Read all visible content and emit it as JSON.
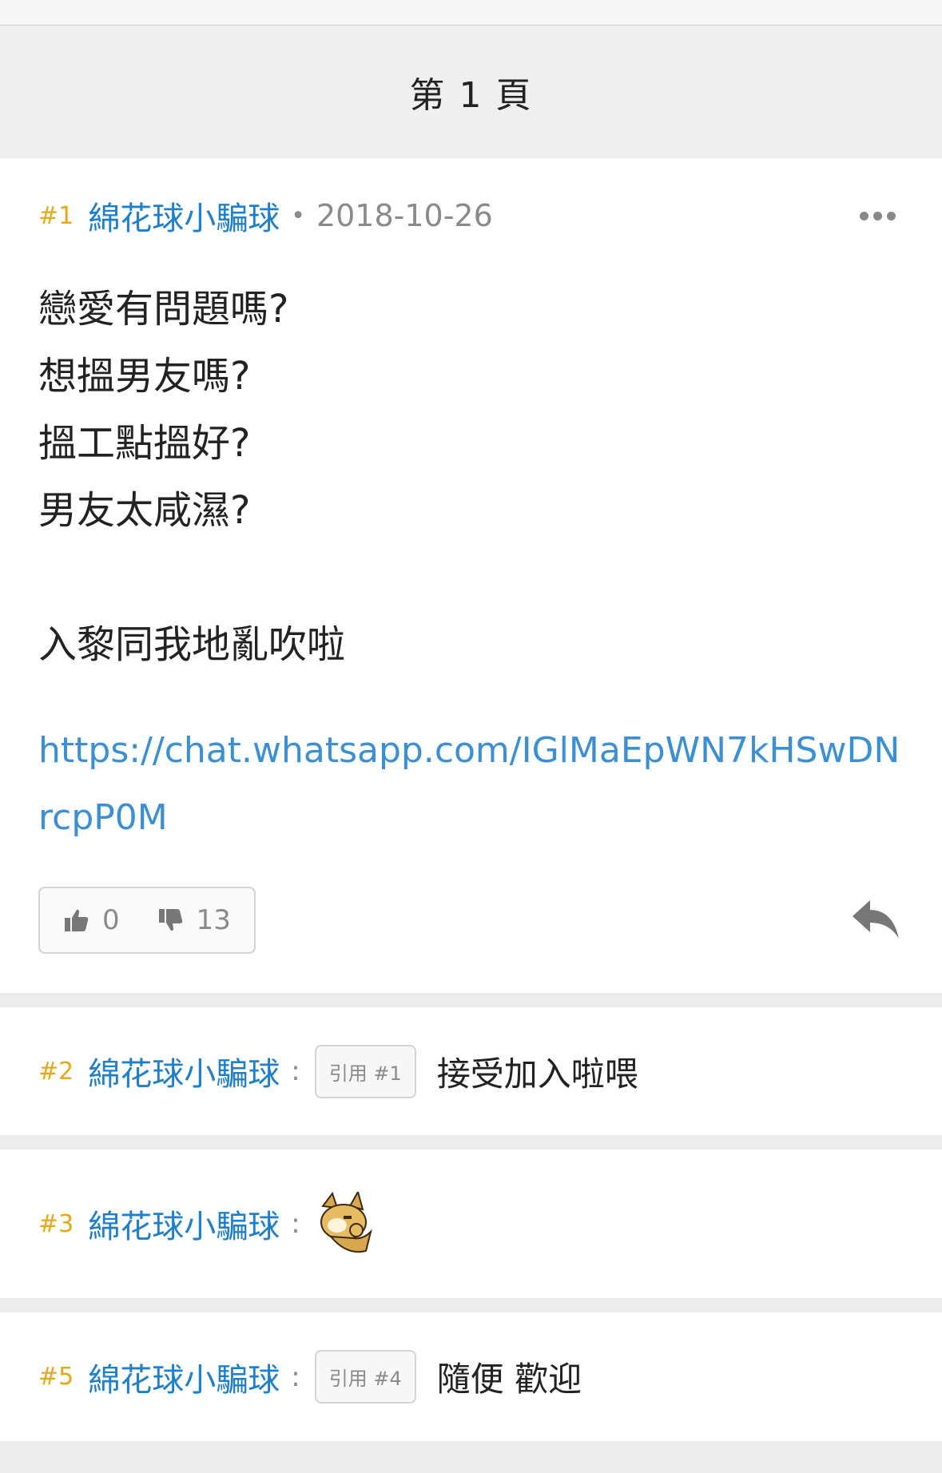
{
  "page_header": {
    "title": "第 1 頁"
  },
  "post": {
    "floor": "#1",
    "author": "綿花球小騙球",
    "separator": "•",
    "date": "2018-10-26",
    "body_lines": [
      "戀愛有問題嗎?",
      "想搵男友嗎?",
      "搵工點搵好?",
      "男友太咸濕?",
      "",
      "入黎同我地亂吹啦"
    ],
    "link": "https://chat.whatsapp.com/IGlMaEpWN7kHSwDNrcpP0M",
    "likes": "0",
    "dislikes": "13"
  },
  "comments": [
    {
      "floor": "#2",
      "author": "綿花球小騙球",
      "colon": ":",
      "quote": "引用 #1",
      "text": "接受加入啦喂"
    },
    {
      "floor": "#3",
      "author": "綿花球小騙球",
      "colon": ":"
    },
    {
      "floor": "#5",
      "author": "綿花球小騙球",
      "colon": ":",
      "quote": "引用 #4",
      "text": "隨便 歡迎"
    }
  ],
  "icons": {
    "more": "more-dots-icon",
    "thumbs_up": "thumbs-up-icon",
    "thumbs_down": "thumbs-down-icon",
    "reply": "reply-icon",
    "sticker": "fox-sticker-icon"
  },
  "colors": {
    "floor": "#e6a817",
    "author": "#1e7fcc",
    "link": "#3a8fd6",
    "muted": "#8a8a8a"
  }
}
